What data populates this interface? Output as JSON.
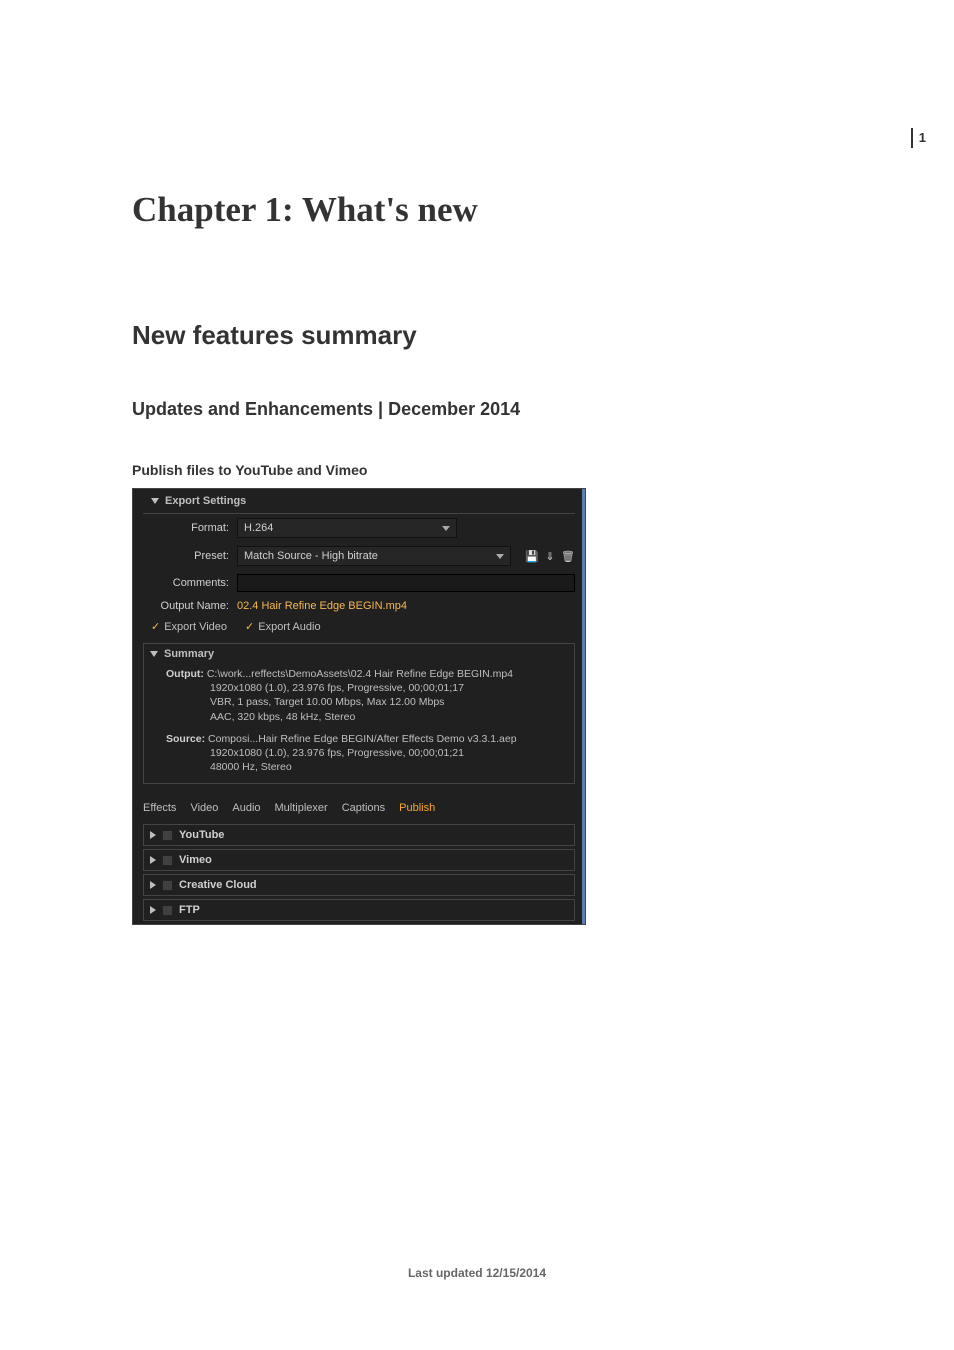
{
  "page_number": "1",
  "chapter_title": "Chapter 1: What's new",
  "section_title": "New features summary",
  "subsection_title": "Updates and Enhancements | December 2014",
  "sub2": "Publish files to YouTube and Vimeo",
  "footer": "Last updated 12/15/2014",
  "screenshot": {
    "export_settings_title": "Export Settings",
    "format_label": "Format:",
    "format_value": "H.264",
    "preset_label": "Preset:",
    "preset_value": "Match Source - High bitrate",
    "comments_label": "Comments:",
    "output_name_label": "Output Name:",
    "output_name_value": "02.4 Hair Refine Edge BEGIN.mp4",
    "export_video": "Export Video",
    "export_audio": "Export Audio",
    "summary_title": "Summary",
    "output_lbl": "Output:",
    "output_line1": "C:\\work...reffects\\DemoAssets\\02.4 Hair Refine Edge BEGIN.mp4",
    "output_line2": "1920x1080 (1.0), 23.976 fps, Progressive, 00;00;01;17",
    "output_line3": "VBR, 1 pass, Target 10.00 Mbps, Max 12.00 Mbps",
    "output_line4": "AAC, 320 kbps, 48 kHz, Stereo",
    "source_lbl": "Source:",
    "source_line1": "Composi...Hair Refine Edge BEGIN/After Effects Demo v3.3.1.aep",
    "source_line2": "1920x1080 (1.0), 23.976 fps, Progressive, 00;00;01;21",
    "source_line3": "48000 Hz, Stereo",
    "tabs": [
      "Effects",
      "Video",
      "Audio",
      "Multiplexer",
      "Captions",
      "Publish"
    ],
    "active_tab": "Publish",
    "publish_groups": [
      "YouTube",
      "Vimeo",
      "Creative Cloud",
      "FTP"
    ]
  }
}
